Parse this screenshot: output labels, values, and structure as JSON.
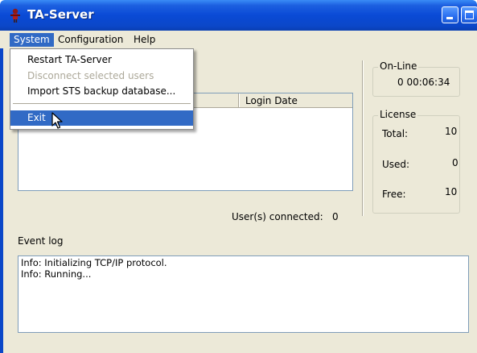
{
  "window": {
    "title": "TA-Server",
    "colors": {
      "titlebar": "#0b47c8",
      "menu_highlight": "#316ac5",
      "face": "#ece9d8",
      "close_button": "#d9432a"
    }
  },
  "menubar": {
    "items": [
      {
        "label": "System",
        "active": true
      },
      {
        "label": "Configuration"
      },
      {
        "label": "Help"
      }
    ]
  },
  "system_menu": {
    "items": [
      {
        "label": "Restart TA-Server",
        "enabled": true
      },
      {
        "label": "Disconnect selected users",
        "enabled": false
      },
      {
        "label": "Import STS backup database...",
        "enabled": true
      },
      {
        "label": "Exit",
        "enabled": true,
        "highlighted": true
      }
    ]
  },
  "users": {
    "columns": [
      "",
      "Login Date"
    ],
    "rows": [],
    "connected_label": "User(s) connected:",
    "connected_count": "0"
  },
  "online": {
    "label": "On-Line",
    "value": "0 00:06:34"
  },
  "license": {
    "label": "License",
    "total_label": "Total:",
    "total": "10",
    "used_label": "Used:",
    "used": "0",
    "free_label": "Free:",
    "free": "10"
  },
  "event_log": {
    "label": "Event log",
    "lines": [
      "Info: Initializing TCP/IP protocol.",
      "Info: Running..."
    ]
  },
  "icons": [
    "app-icon",
    "minimize-icon",
    "maximize-icon",
    "close-icon",
    "mouse-cursor-icon"
  ]
}
